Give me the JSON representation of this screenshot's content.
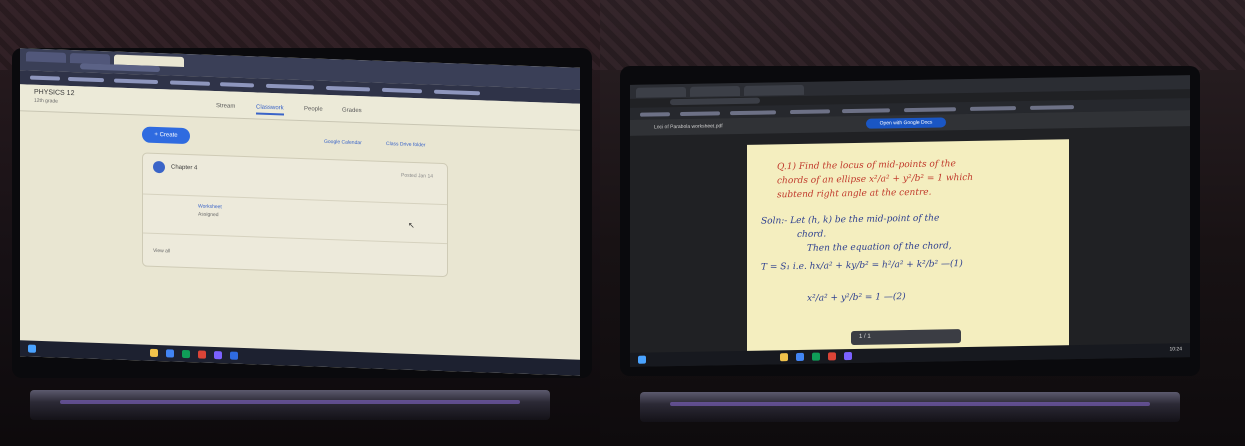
{
  "left_screen": {
    "class_title": "PHYSICS 12",
    "class_subtitle": "12th grade",
    "tabs": [
      "Stream",
      "Classwork",
      "People",
      "Grades"
    ],
    "active_tab": "Classwork",
    "create_label": "+ Create",
    "links": [
      "Google Calendar",
      "Class Drive folder"
    ],
    "topic_title": "Chapter 4",
    "topic_date": "Posted Jan 14",
    "item_title": "Worksheet",
    "item_sub": "Assigned",
    "view_all": "View all"
  },
  "right_screen": {
    "file_name": "Loci of Parabola worksheet.pdf",
    "open_with": "Open with Google Docs",
    "note_lines": [
      {
        "text": "Q.1) Find the locus of mid-points of the",
        "color": "red"
      },
      {
        "text": "chords of an ellipse x²/a² + y²/b² = 1 which",
        "color": "red"
      },
      {
        "text": "subtend right angle at the centre.",
        "color": "red"
      },
      {
        "text": "Soln:- Let (h, k) be the mid-point of the",
        "color": "blue"
      },
      {
        "text": "chord.",
        "color": "blue"
      },
      {
        "text": "Then the equation of the chord,",
        "color": "blue"
      },
      {
        "text": "T = S₁  i.e.  hx/a² + ky/b² = h²/a² + k²/b²  —(1)",
        "color": "blue"
      },
      {
        "text": "x²/a² + y²/b² = 1   —(2)",
        "color": "blue"
      }
    ],
    "zoom": "1 / 1",
    "clock": "10:24"
  },
  "colors": {
    "laptop_glow": "#8a6cd6",
    "classroom_accent": "#2f6be0",
    "ink_red": "#c0392b",
    "ink_blue": "#2c3e8f"
  }
}
